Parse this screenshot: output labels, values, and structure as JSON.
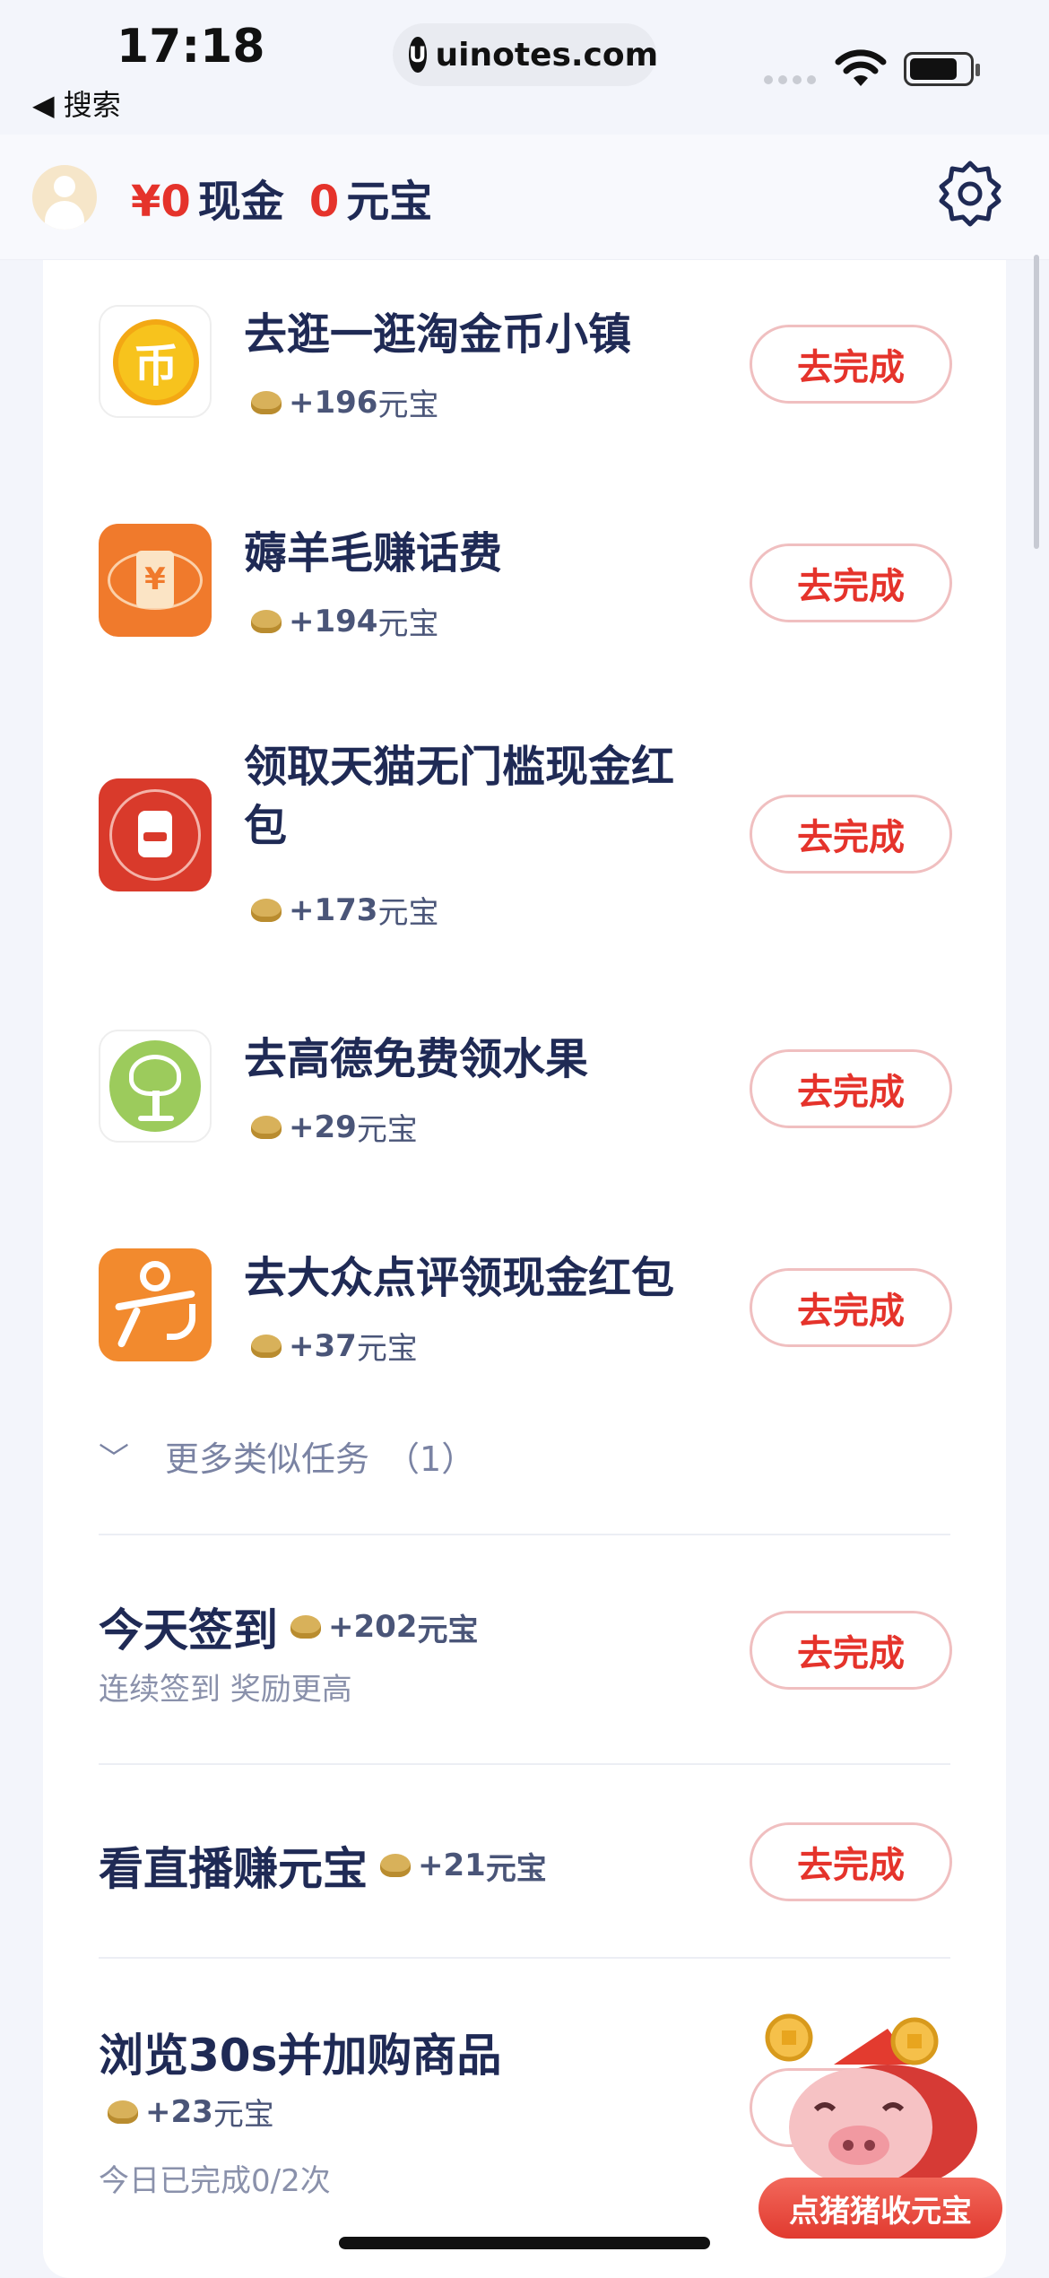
{
  "status": {
    "time": "17:18",
    "back_label": "◀ 搜索",
    "url": "uinotes.com",
    "url_logo": "U"
  },
  "header": {
    "cash_amount": "¥0",
    "cash_label": "现金",
    "ingot_amount": "0",
    "ingot_label": "元宝"
  },
  "tasks": [
    {
      "title": "去逛一逛淘金币小镇",
      "reward": "+196",
      "unit": "元宝",
      "button": "去完成",
      "icon": "coin-icon",
      "color": "#f5c51a"
    },
    {
      "title": "薅羊毛赚话费",
      "reward": "+194",
      "unit": "元宝",
      "button": "去完成",
      "icon": "phone-bill-icon",
      "color": "#f07a2c"
    },
    {
      "title": "领取天猫无门槛现金红包",
      "reward": "+173",
      "unit": "元宝",
      "button": "去完成",
      "icon": "tmall-icon",
      "color": "#d93a2b"
    },
    {
      "title": "去高德免费领水果",
      "reward": "+29",
      "unit": "元宝",
      "button": "去完成",
      "icon": "tree-icon",
      "color": "#9ccb5c"
    },
    {
      "title": "去大众点评领现金红包",
      "reward": "+37",
      "unit": "元宝",
      "button": "去完成",
      "icon": "dianping-icon",
      "color": "#f28a2e"
    }
  ],
  "more": {
    "label": "更多类似任务",
    "count": "（1）"
  },
  "checkin": {
    "title": "今天签到",
    "reward": "+202",
    "unit": "元宝",
    "sub": "连续签到 奖励更高",
    "button": "去完成"
  },
  "live": {
    "title": "看直播赚元宝",
    "reward": "+21",
    "unit": "元宝",
    "button": "去完成"
  },
  "browse": {
    "title": "浏览30s并加购商品",
    "reward": "+23",
    "unit": "元宝",
    "sub": "今日已完成0/2次"
  },
  "pig": {
    "label": "点猪猪收元宝"
  }
}
